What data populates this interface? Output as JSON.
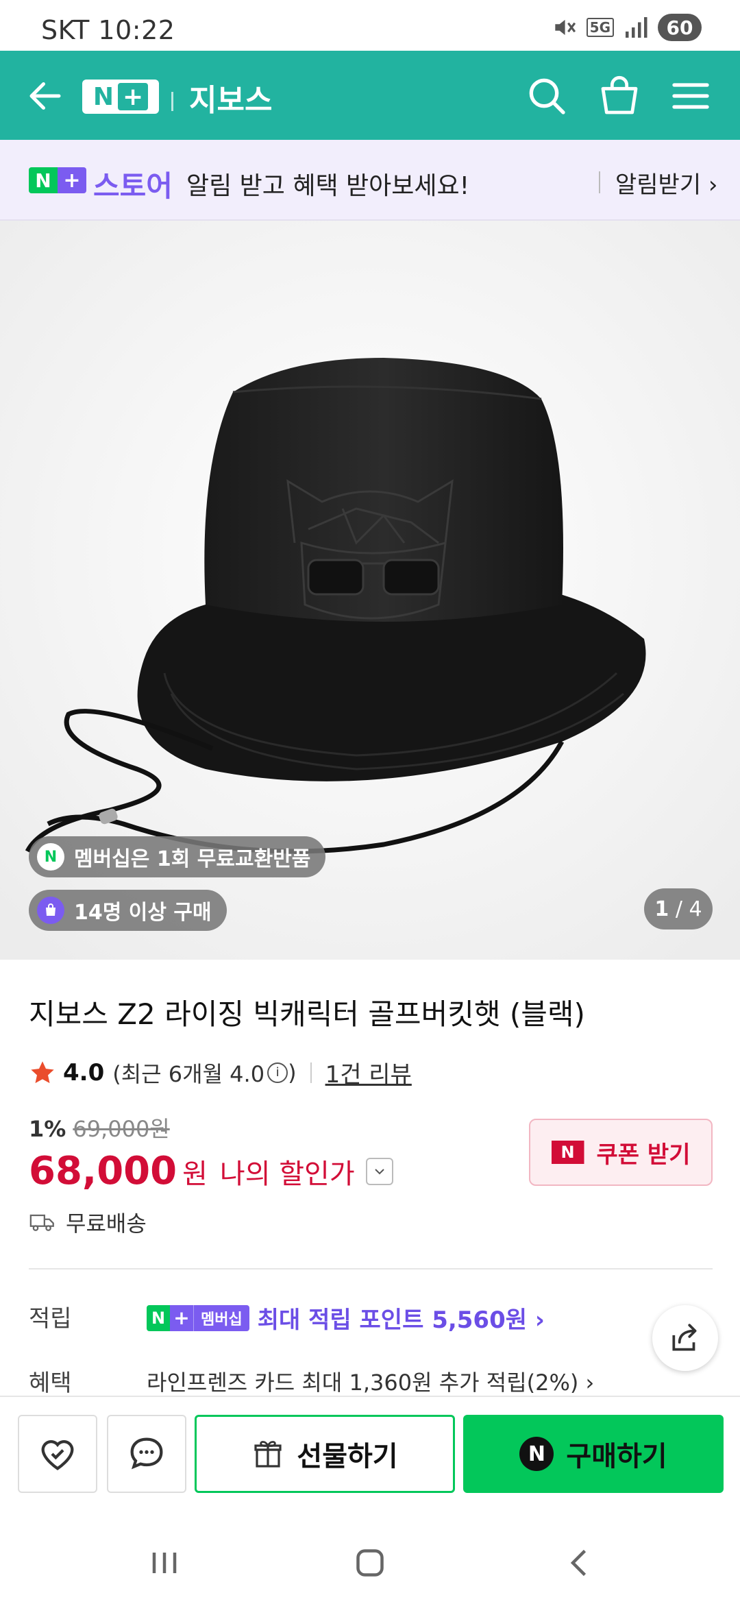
{
  "status_bar": {
    "carrier": "SKT",
    "time": "10:22",
    "network": "5G",
    "battery": "60"
  },
  "header": {
    "brand": "지보스",
    "nplus_n": "N",
    "nplus_plus": "+"
  },
  "store_banner": {
    "n": "N",
    "plus": "+",
    "store": "스토어",
    "message": "알림 받고 혜택 받아보세요!",
    "link": "알림받기 ›"
  },
  "image_overlay": {
    "membership_pill": "멤버십은 1회 무료교환반품",
    "membership_icon": "N",
    "buyers_pill": "14명 이상 구매",
    "page_current": "1",
    "page_total": "/ 4"
  },
  "product": {
    "title": "지보스 Z2 라이징 빅캐릭터 골프버킷햇 (블랙)",
    "rating": "4.0",
    "rating_recent": "(최근 6개월 4.0",
    "rating_close": ")",
    "review_count": "1건 리뷰",
    "discount_pct": "1%",
    "original_price": "69,000원",
    "price": "68,000",
    "price_unit": "원",
    "price_label": "나의 할인가",
    "coupon_label": "쿠폰 받기",
    "coupon_icon": "N",
    "shipping": "무료배송"
  },
  "benefits": {
    "points_label": "적립",
    "member_n": "N",
    "member_plus": "+",
    "member_badge": "멤버십",
    "points_text": "최대 적립 포인트 5,560원 ›",
    "benefit_label": "혜택",
    "benefit_text": "라인프렌즈 카드 최대 1,360원 추가 적립(2%) ›"
  },
  "bottom_bar": {
    "gift_label": "선물하기",
    "buy_label": "구매하기",
    "buy_icon": "N"
  },
  "colors": {
    "header": "#22b3a0",
    "banner_bg": "#f2eefc",
    "accent_purple": "#7b5cf0",
    "naver_green": "#03c75a",
    "price_red": "#d20d37"
  }
}
